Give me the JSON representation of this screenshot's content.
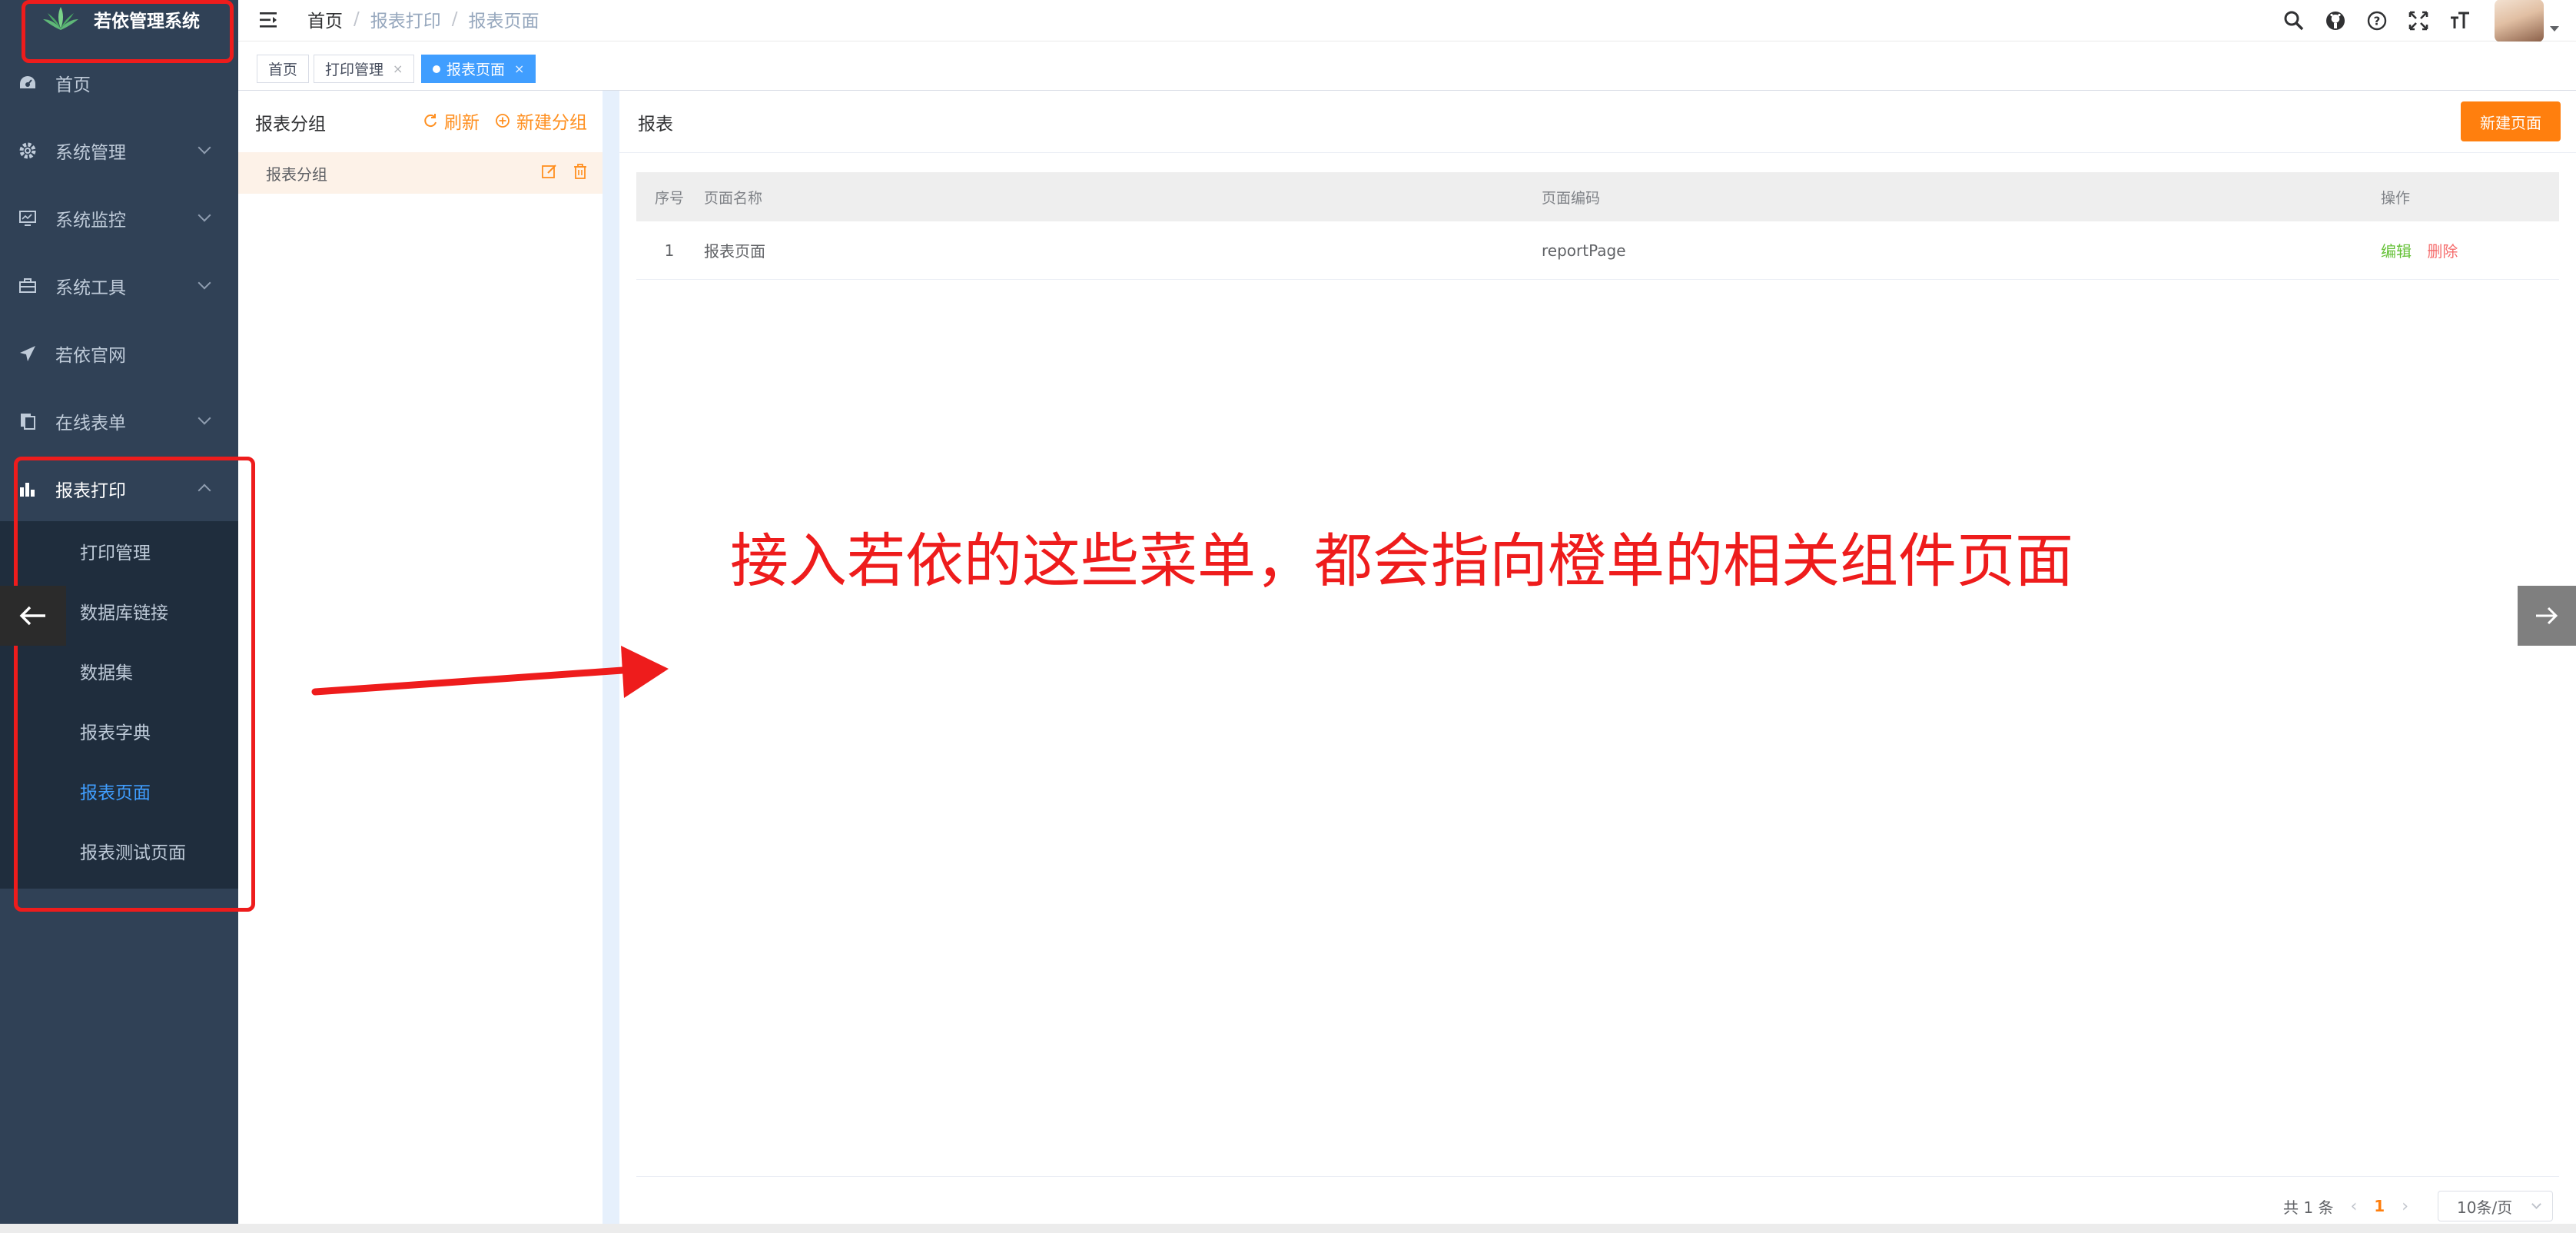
{
  "app": {
    "title": "若依管理系统"
  },
  "sidebar": {
    "items": [
      {
        "label": "首页",
        "icon": "dashboard-icon"
      },
      {
        "label": "系统管理",
        "icon": "gear-icon"
      },
      {
        "label": "系统监控",
        "icon": "monitor-icon"
      },
      {
        "label": "系统工具",
        "icon": "toolbox-icon"
      },
      {
        "label": "若依官网",
        "icon": "send-icon"
      },
      {
        "label": "在线表单",
        "icon": "form-icon"
      },
      {
        "label": "报表打印",
        "icon": "bar-chart-icon"
      }
    ],
    "submenu": [
      "打印管理",
      "数据库链接",
      "数据集",
      "报表字典",
      "报表页面",
      "报表测试页面"
    ]
  },
  "breadcrumb": {
    "home": "首页",
    "sep": "/",
    "level1": "报表打印",
    "level2": "报表页面"
  },
  "tags": {
    "home": "首页",
    "print_manage": "打印管理",
    "report_page": "报表页面",
    "close": "×"
  },
  "group_panel": {
    "title": "报表分组",
    "refresh": "刷新",
    "new_group": "新建分组",
    "group_name": "报表分组"
  },
  "report_panel": {
    "title": "报表",
    "new_page": "新建页面",
    "columns": {
      "idx": "序号",
      "name": "页面名称",
      "code": "页面编码",
      "op": "操作"
    },
    "rows": [
      {
        "idx": "1",
        "name": "报表页面",
        "code": "reportPage",
        "edit": "编辑",
        "delete": "删除"
      }
    ]
  },
  "pagination": {
    "total": "共 1 条",
    "page": "1",
    "page_size": "10条/页"
  },
  "annotation": {
    "text": "接入若依的这些菜单，都会指向橙单的相关组件页面"
  },
  "colors": {
    "sidebar_bg": "#304156",
    "submenu_bg": "#1f2d3d",
    "accent_blue": "#409eff",
    "accent_orange": "#ff7f0e",
    "annotation_red": "#ee1c1c"
  }
}
